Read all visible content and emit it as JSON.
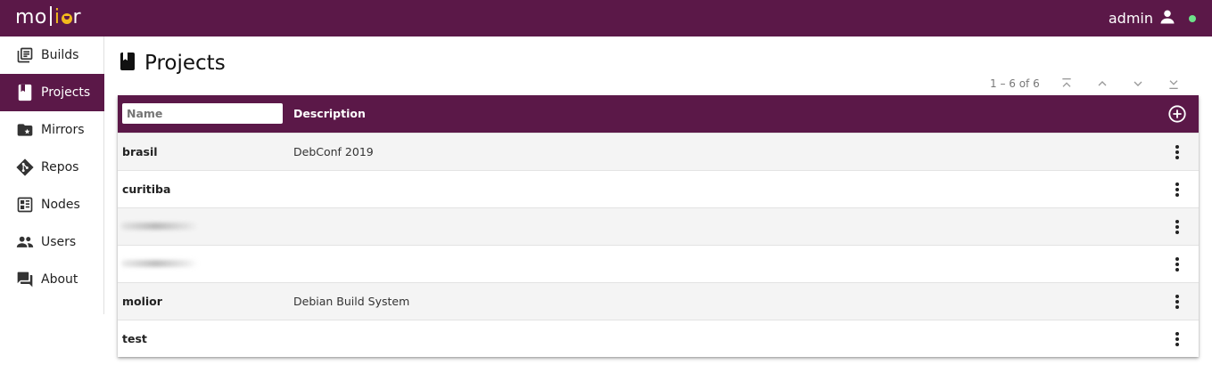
{
  "app": {
    "logo_left": "mo",
    "logo_i": "i",
    "logo_right": "r",
    "user": "admin",
    "status_color": "#6ee08a",
    "brand_color": "#5b1848"
  },
  "sidebar": {
    "items": [
      {
        "label": "Builds",
        "icon": "builds-icon",
        "active": false
      },
      {
        "label": "Projects",
        "icon": "book-icon",
        "active": true
      },
      {
        "label": "Mirrors",
        "icon": "folder-star-icon",
        "active": false
      },
      {
        "label": "Repos",
        "icon": "git-icon",
        "active": false
      },
      {
        "label": "Nodes",
        "icon": "nodes-icon",
        "active": false
      },
      {
        "label": "Users",
        "icon": "users-icon",
        "active": false
      },
      {
        "label": "About",
        "icon": "forum-icon",
        "active": false
      }
    ]
  },
  "page": {
    "title": "Projects"
  },
  "pager": {
    "range": "1 – 6 of 6"
  },
  "table": {
    "name_filter_placeholder": "Name",
    "desc_header": "Description",
    "rows": [
      {
        "name": "brasil",
        "description": "DebConf 2019",
        "blurred": false
      },
      {
        "name": "curitiba",
        "description": "",
        "blurred": false
      },
      {
        "name": "",
        "description": "",
        "blurred": true
      },
      {
        "name": "",
        "description": "",
        "blurred": true
      },
      {
        "name": "molior",
        "description": "Debian Build System",
        "blurred": false
      },
      {
        "name": "test",
        "description": "",
        "blurred": false
      }
    ]
  }
}
